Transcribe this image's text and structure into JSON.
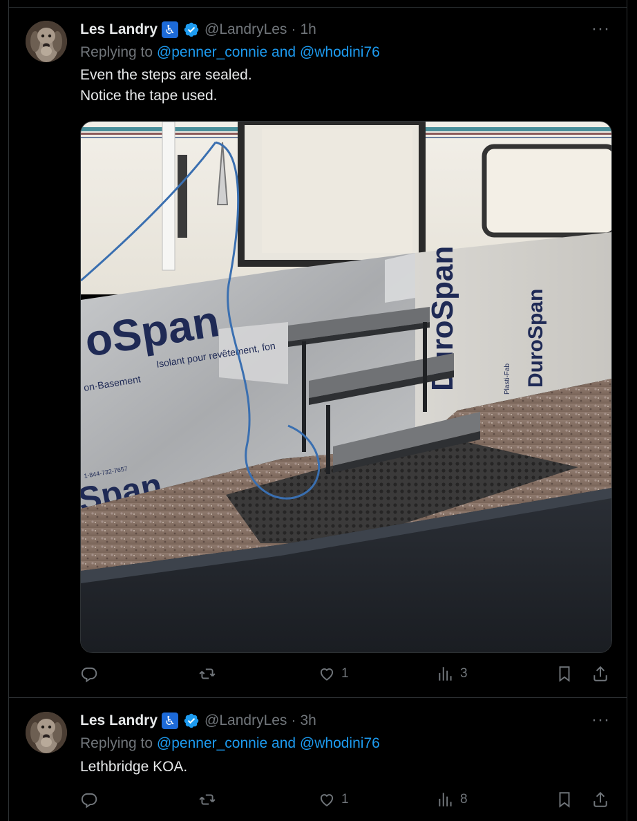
{
  "tweets": [
    {
      "display_name": "Les Landry",
      "name_emoji": "♿",
      "handle": "@LandryLes",
      "separator": "·",
      "time": "1h",
      "more_label": "···",
      "replying_prefix": "Replying to ",
      "mention_1": "@penner_connie",
      "conjunction": " and ",
      "mention_2": "@whodini76",
      "text": "Even the steps are sealed.\nNotice the tape used.",
      "has_image": true,
      "image_description_icon": "photo",
      "stats": {
        "replies": "",
        "reposts": "",
        "likes": "1",
        "views": "3"
      }
    },
    {
      "display_name": "Les Landry",
      "name_emoji": "♿",
      "handle": "@LandryLes",
      "separator": "·",
      "time": "3h",
      "more_label": "···",
      "replying_prefix": "Replying to ",
      "mention_1": "@penner_connie",
      "conjunction": " and ",
      "mention_2": "@whodini76",
      "text": "Lethbridge KOA.",
      "has_image": false,
      "stats": {
        "replies": "",
        "reposts": "",
        "likes": "1",
        "views": "8"
      }
    }
  ],
  "photo_text": {
    "brand_left": "Span",
    "brand_prefix": "o",
    "tagline": "Isolant pour revêtement, fon",
    "basement": "on·Basement",
    "phone": "1-844-732-7657",
    "brand_right": "DuroSpan",
    "brand_right_2": "DuroSpan",
    "maker": "Plasti-Fab"
  },
  "colors": {
    "background": "#000000",
    "text": "#e7e9ea",
    "muted": "#71767b",
    "link": "#1d9bf0",
    "border": "#2f3336",
    "verified": "#1d9bf0"
  }
}
